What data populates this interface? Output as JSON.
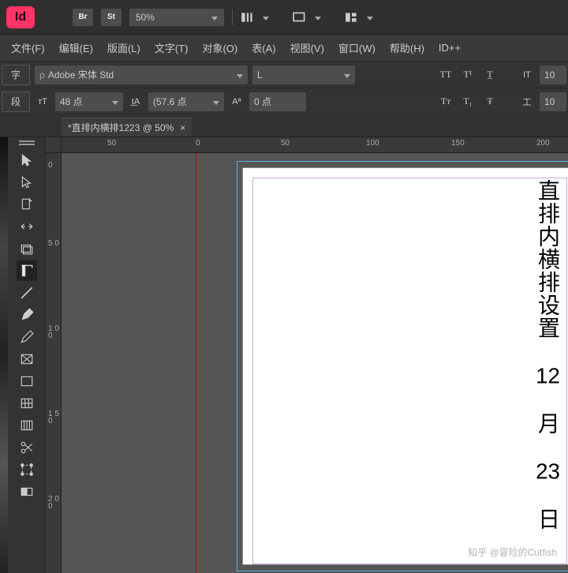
{
  "app": {
    "logo_text": "Id"
  },
  "titlebar": {
    "btn_br": "Br",
    "btn_st": "St",
    "zoom_value": "50%"
  },
  "menubar": {
    "file": "文件(F)",
    "edit": "编辑(E)",
    "layout": "版面(L)",
    "type": "文字(T)",
    "object": "对象(O)",
    "table": "表(A)",
    "view": "视图(V)",
    "window": "窗口(W)",
    "help": "帮助(H)",
    "idplus": "ID++"
  },
  "ctrl1": {
    "tab_char": "字",
    "font_prefix": "ρ",
    "font_name": "Adobe 宋体 Std",
    "font_style": "L",
    "tt_plain": "TT",
    "tt_sup": "T¹",
    "vert_scale_icon": "IT",
    "vert_scale_value": "10"
  },
  "ctrl2": {
    "tab_para": "段",
    "size_icon": "тT",
    "size_value": "48 点",
    "leading_icon": "t͟A",
    "leading_value": "(57.6 点",
    "baseline_icon": "Aª",
    "baseline_value": "0 点",
    "smallcap": "Tт",
    "subscript": "T₁",
    "strike": "Ŧ",
    "horiz_icon": "工",
    "horiz_value": "10"
  },
  "tabs": {
    "doc_name": "*直排内横排1223 @ 50%"
  },
  "hruler_ticks": [
    "50",
    "0",
    "50",
    "100",
    "150",
    "200"
  ],
  "vruler_ticks": [
    "0",
    "5 0",
    "1 0 0",
    "1 5 0",
    "2 0 0"
  ],
  "page_text": {
    "line": "直排内横排设置",
    "n12": "12",
    "month": "月",
    "n23": "23",
    "day": "日"
  },
  "watermark": "知乎 @冒险的Cutfish"
}
